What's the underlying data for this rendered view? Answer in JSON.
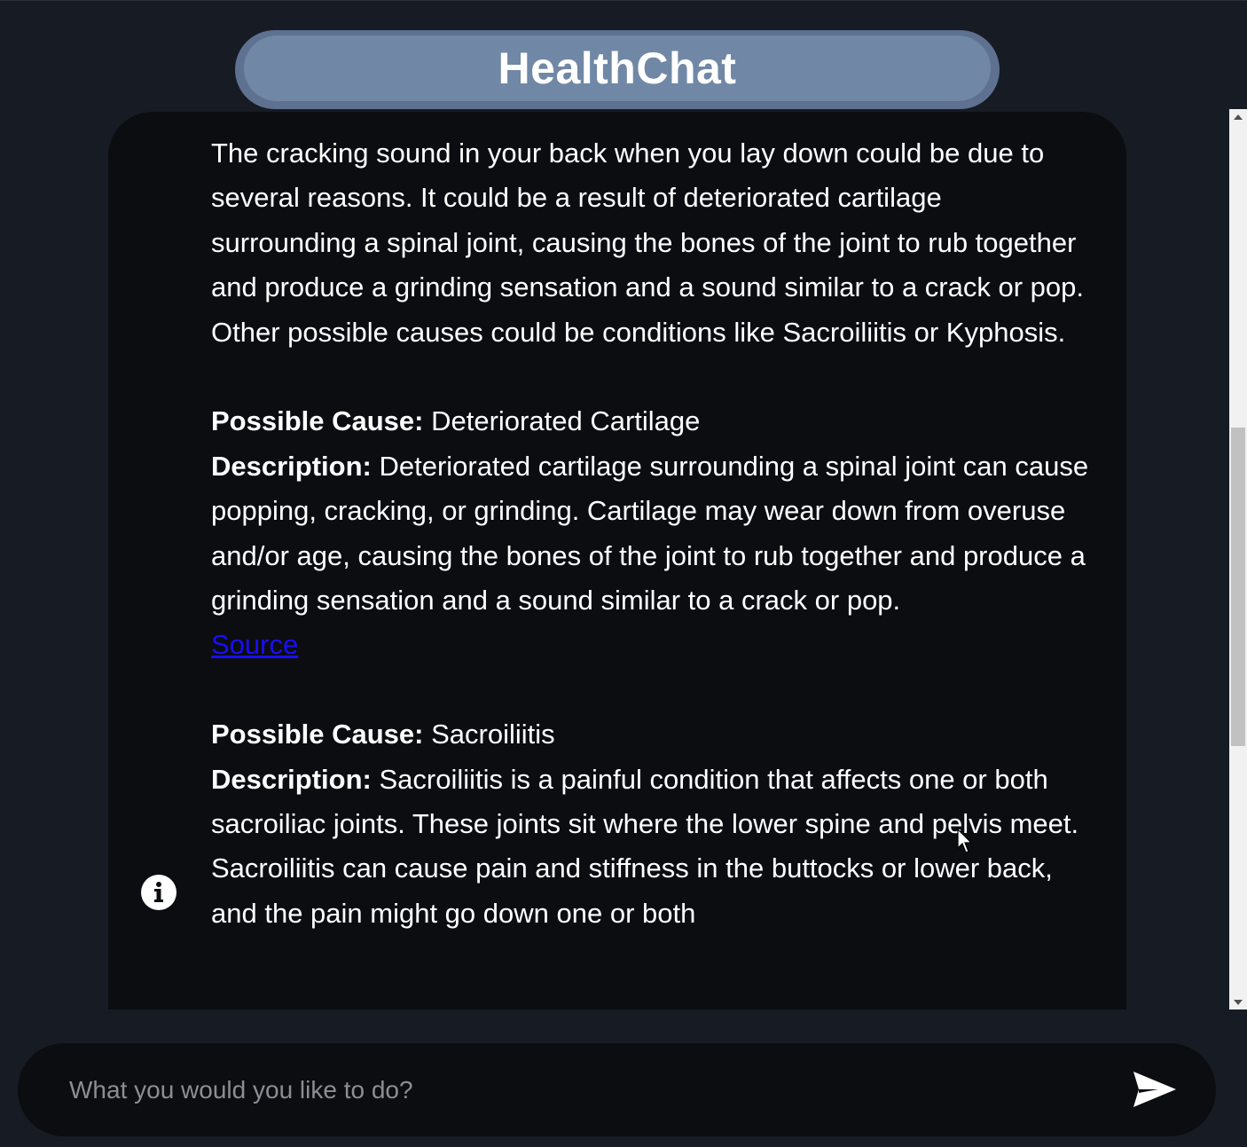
{
  "header": {
    "title": "HealthChat"
  },
  "chat": {
    "message": {
      "intro": "The cracking sound in your back when you lay down could be due to several reasons. It could be a result of deteriorated cartilage surrounding a spinal joint, causing the bones of the joint to rub together and produce a grinding sensation and a sound similar to a crack or pop. Other possible causes could be conditions like Sacroiliitis or Kyphosis.",
      "causes": [
        {
          "cause_label": "Possible Cause:",
          "cause": "Deteriorated Cartilage",
          "description_label": "Description:",
          "description": "Deteriorated cartilage surrounding a spinal joint can cause popping, cracking, or grinding. Cartilage may wear down from overuse and/or age, causing the bones of the joint to rub together and produce a grinding sensation and a sound similar to a crack or pop.",
          "source_label": "Source"
        },
        {
          "cause_label": "Possible Cause:",
          "cause": "Sacroiliitis",
          "description_label": "Description:",
          "description": "Sacroiliitis is a painful condition that affects one or both sacroiliac joints. These joints sit where the lower spine and pelvis meet. Sacroiliitis can cause pain and stiffness in the buttocks or lower back, and the pain might go down one or both"
        }
      ],
      "icon": "info-icon"
    }
  },
  "composer": {
    "placeholder": "What you would you like to do?",
    "value": "",
    "send_icon": "send-icon"
  },
  "colors": {
    "background": "#171b23",
    "panel": "#0b0d11",
    "title_pill": "#7088a5",
    "link": "#1a0dff"
  }
}
